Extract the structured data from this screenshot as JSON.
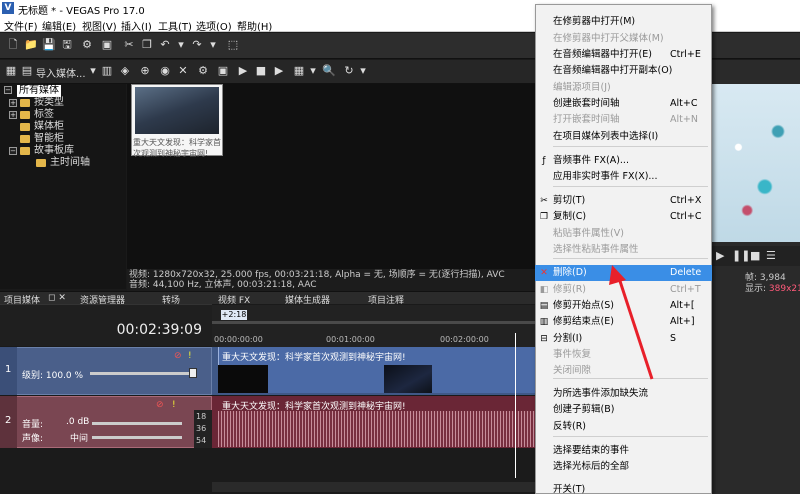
{
  "window": {
    "title": "无标题 * - VEGAS Pro 17.0",
    "controls": [
      "—",
      "☐",
      "✕"
    ]
  },
  "menubar": [
    "文件(F)",
    "编辑(E)",
    "视图(V)",
    "插入(I)",
    "工具(T)",
    "选项(O)",
    "帮助(H)"
  ],
  "toolbar2": {
    "import_label": "导入媒体..."
  },
  "tree": {
    "items": [
      "所有媒体",
      "按类型",
      "标签",
      "媒体柜",
      "智能柜",
      "故事板库",
      "主时间轴"
    ]
  },
  "media": {
    "thumb_caption": "重大天文发现：科学家首次观测到神秘宇宙网!",
    "info_line1": "视频: 1280x720x32, 25.000 fps, 00:03:21:18, Alpha = 无, 场顺序 = 无(逐行扫描), AVC",
    "info_line2": "音频: 44,100 Hz, 立体声, 00:03:21:18, AAC"
  },
  "tabs": [
    "项目媒体",
    "资源管理器",
    "转场",
    "视频 FX",
    "媒体生成器",
    "项目注释"
  ],
  "timeline": {
    "timecode": "00:02:39:09",
    "marker": "+2:18",
    "ruler": [
      "00:00:00:00",
      "00:01:00:00",
      "00:02:00:00"
    ],
    "video_track": {
      "number": "1",
      "level_label": "级别: 100.0 %",
      "clip_title": "重大天文发现：科学家首次观测到神秘宇宙网!"
    },
    "audio_track": {
      "number": "2",
      "volume_label": "音量:",
      "volume_value": ".0 dB",
      "pan_label": "声像:",
      "pan_value": "中间",
      "meter": [
        "18",
        "36",
        "54"
      ],
      "clip_title": "重大天文发现：科学家首次观测到神秘宇宙网!"
    }
  },
  "preview": {
    "frame_label": "帧:",
    "frame_value": "3,984",
    "display_label": "显示:",
    "display_value": "389x21"
  },
  "context_menu": {
    "items": [
      {
        "label": "在修剪器中打开(M)",
        "shortcut": "",
        "disabled": false
      },
      {
        "label": "在修剪器中打开父媒体(M)",
        "shortcut": "",
        "disabled": true
      },
      {
        "label": "在音频编辑器中打开(E)",
        "shortcut": "Ctrl+E",
        "disabled": false
      },
      {
        "label": "在音频编辑器中打开副本(O)",
        "shortcut": "",
        "disabled": false
      },
      {
        "label": "编辑源项目(J)",
        "shortcut": "",
        "disabled": true
      },
      {
        "label": "创建嵌套时间轴",
        "shortcut": "Alt+C",
        "disabled": false
      },
      {
        "label": "打开嵌套时间轴",
        "shortcut": "Alt+N",
        "disabled": true
      },
      {
        "label": "在项目媒体列表中选择(I)",
        "shortcut": "",
        "disabled": false
      },
      {
        "label": "音频事件 FX(A)...",
        "shortcut": "",
        "disabled": false
      },
      {
        "label": "应用非实时事件 FX(X)...",
        "shortcut": "",
        "disabled": false
      },
      {
        "label": "剪切(T)",
        "shortcut": "Ctrl+X",
        "disabled": false
      },
      {
        "label": "复制(C)",
        "shortcut": "Ctrl+C",
        "disabled": false
      },
      {
        "label": "粘贴事件属性(V)",
        "shortcut": "",
        "disabled": true
      },
      {
        "label": "选择性粘贴事件属性",
        "shortcut": "",
        "disabled": true
      },
      {
        "label": "删除(D)",
        "shortcut": "Delete",
        "disabled": false,
        "highlighted": true
      },
      {
        "label": "修剪(R)",
        "shortcut": "Ctrl+T",
        "disabled": true
      },
      {
        "label": "修剪开始点(S)",
        "shortcut": "Alt+[",
        "disabled": false
      },
      {
        "label": "修剪结束点(E)",
        "shortcut": "Alt+]",
        "disabled": false
      },
      {
        "label": "分割(I)",
        "shortcut": "S",
        "disabled": false
      },
      {
        "label": "事件恢复",
        "shortcut": "",
        "disabled": true
      },
      {
        "label": "关闭间隙",
        "shortcut": "",
        "disabled": true
      },
      {
        "label": "为所选事件添加缺失流",
        "shortcut": "",
        "disabled": false
      },
      {
        "label": "创建子剪辑(B)",
        "shortcut": "",
        "disabled": false
      },
      {
        "label": "反转(R)",
        "shortcut": "",
        "disabled": false
      },
      {
        "label": "选择要结束的事件",
        "shortcut": "",
        "disabled": false
      },
      {
        "label": "选择光标后的全部",
        "shortcut": "",
        "disabled": false
      },
      {
        "label": "开关(T)",
        "shortcut": "",
        "disabled": false
      }
    ]
  },
  "colors": {
    "menu_highlight": "#3a8ee6",
    "video_track": "#4a5f8a",
    "audio_track": "#7a4652",
    "arrow": "#e8202a"
  }
}
